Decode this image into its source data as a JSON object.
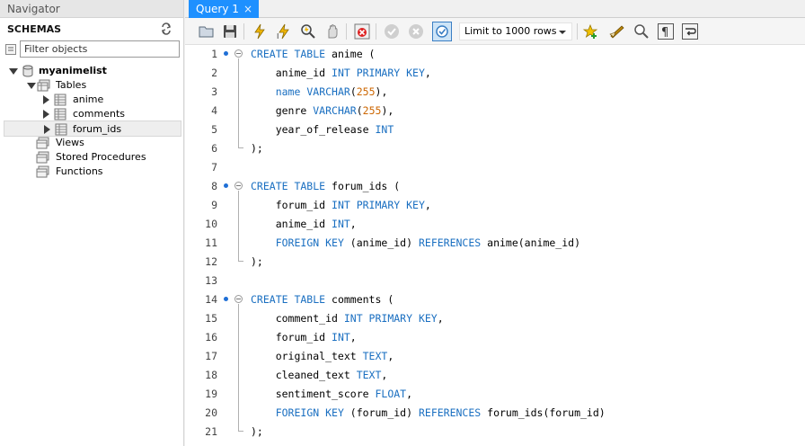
{
  "navigator": {
    "title": "Navigator",
    "schemas_label": "SCHEMAS",
    "filter_placeholder": "Filter objects",
    "schema_name": "myanimelist",
    "tables_label": "Tables",
    "tables": [
      "anime",
      "comments",
      "forum_ids"
    ],
    "selected_table": "forum_ids",
    "views_label": "Views",
    "procedures_label": "Stored Procedures",
    "functions_label": "Functions"
  },
  "tabs": [
    {
      "label": "Query 1",
      "active": true,
      "close": "×"
    }
  ],
  "toolbar": {
    "limit_value": "Limit to 1000 rows",
    "icons": [
      "open-folder-icon",
      "save-icon",
      "execute-icon",
      "execute-statement-icon",
      "explain-icon",
      "stop-icon",
      "toggle-continue-on-error-icon",
      "commit-icon",
      "rollback-icon",
      "autocommit-icon",
      "add-snippet-icon",
      "beautify-icon",
      "find-replace-icon",
      "invisible-characters-icon",
      "word-wrap-icon"
    ]
  },
  "colors": {
    "keyword": "#1a6fc1",
    "number": "#cc6600",
    "tab_active": "#1e90ff",
    "breakpoint": "#1f6fd6"
  },
  "editor": {
    "lines": [
      {
        "n": "1",
        "tokens": [
          [
            "kw",
            "CREATE TABLE"
          ],
          [
            "t",
            " anime ("
          ]
        ]
      },
      {
        "n": "2",
        "tokens": [
          [
            "t",
            "    anime_id "
          ],
          [
            "kw",
            "INT PRIMARY KEY"
          ],
          [
            "t",
            ","
          ]
        ]
      },
      {
        "n": "3",
        "tokens": [
          [
            "t",
            "    "
          ],
          [
            "kw",
            "name"
          ],
          [
            "t",
            " "
          ],
          [
            "kw",
            "VARCHAR"
          ],
          [
            "t",
            "("
          ],
          [
            "num",
            "255"
          ],
          [
            "t",
            "),"
          ]
        ]
      },
      {
        "n": "4",
        "tokens": [
          [
            "t",
            "    genre "
          ],
          [
            "kw",
            "VARCHAR"
          ],
          [
            "t",
            "("
          ],
          [
            "num",
            "255"
          ],
          [
            "t",
            "),"
          ]
        ]
      },
      {
        "n": "5",
        "tokens": [
          [
            "t",
            "    year_of_release "
          ],
          [
            "kw",
            "INT"
          ]
        ]
      },
      {
        "n": "6",
        "tokens": [
          [
            "t",
            ");"
          ]
        ]
      },
      {
        "n": "7",
        "tokens": []
      },
      {
        "n": "8",
        "tokens": [
          [
            "kw",
            "CREATE TABLE"
          ],
          [
            "t",
            " forum_ids ("
          ]
        ]
      },
      {
        "n": "9",
        "tokens": [
          [
            "t",
            "    forum_id "
          ],
          [
            "kw",
            "INT PRIMARY KEY"
          ],
          [
            "t",
            ","
          ]
        ]
      },
      {
        "n": "10",
        "tokens": [
          [
            "t",
            "    anime_id "
          ],
          [
            "kw",
            "INT"
          ],
          [
            "t",
            ","
          ]
        ]
      },
      {
        "n": "11",
        "tokens": [
          [
            "t",
            "    "
          ],
          [
            "kw",
            "FOREIGN KEY"
          ],
          [
            "t",
            " (anime_id) "
          ],
          [
            "kw",
            "REFERENCES"
          ],
          [
            "t",
            " anime(anime_id)"
          ]
        ]
      },
      {
        "n": "12",
        "tokens": [
          [
            "t",
            ");"
          ]
        ]
      },
      {
        "n": "13",
        "tokens": []
      },
      {
        "n": "14",
        "tokens": [
          [
            "kw",
            "CREATE TABLE"
          ],
          [
            "t",
            " comments ("
          ]
        ]
      },
      {
        "n": "15",
        "tokens": [
          [
            "t",
            "    comment_id "
          ],
          [
            "kw",
            "INT PRIMARY KEY"
          ],
          [
            "t",
            ","
          ]
        ]
      },
      {
        "n": "16",
        "tokens": [
          [
            "t",
            "    forum_id "
          ],
          [
            "kw",
            "INT"
          ],
          [
            "t",
            ","
          ]
        ]
      },
      {
        "n": "17",
        "tokens": [
          [
            "t",
            "    original_text "
          ],
          [
            "kw",
            "TEXT"
          ],
          [
            "t",
            ","
          ]
        ]
      },
      {
        "n": "18",
        "tokens": [
          [
            "t",
            "    cleaned_text "
          ],
          [
            "kw",
            "TEXT"
          ],
          [
            "t",
            ","
          ]
        ]
      },
      {
        "n": "19",
        "tokens": [
          [
            "t",
            "    sentiment_score "
          ],
          [
            "kw",
            "FLOAT"
          ],
          [
            "t",
            ","
          ]
        ]
      },
      {
        "n": "20",
        "tokens": [
          [
            "t",
            "    "
          ],
          [
            "kw",
            "FOREIGN KEY"
          ],
          [
            "t",
            " (forum_id) "
          ],
          [
            "kw",
            "REFERENCES"
          ],
          [
            "t",
            " forum_ids(forum_id)"
          ]
        ]
      },
      {
        "n": "21",
        "tokens": [
          [
            "t",
            ");"
          ]
        ]
      }
    ]
  }
}
